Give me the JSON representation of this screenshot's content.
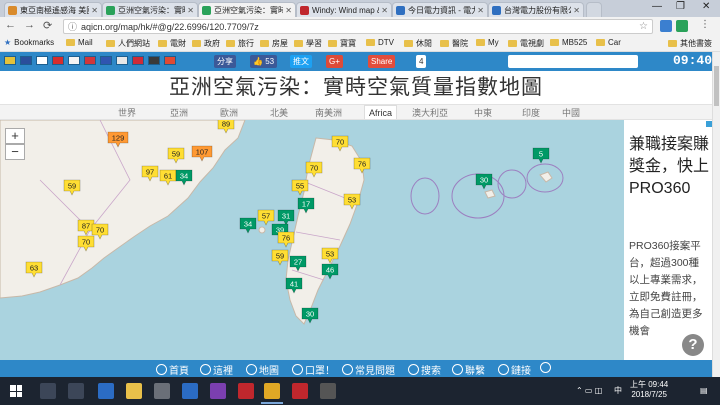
{
  "browser": {
    "tabs": [
      {
        "label": "東亞南極遙感海 美國",
        "color": "#d98b2c",
        "active": false
      },
      {
        "label": "亞洲空氣污染：實時",
        "color": "#2aa25a",
        "active": false
      },
      {
        "label": "亞洲空氣污染：實時",
        "color": "#2aa25a",
        "active": true
      },
      {
        "label": "Windy: Wind map & ",
        "color": "#c0272d",
        "active": false
      },
      {
        "label": "今日電力資訊 - 電力",
        "color": "#2f6fc0",
        "active": false
      },
      {
        "label": "台灣電力股份有限公",
        "color": "#2f6fc0",
        "active": false
      }
    ],
    "url": "aqicn.org/map/hk/#@g/22.6996/120.7709/7z",
    "bookmarks": [
      "Bookmarks",
      "Mail",
      "人們網站",
      "電財",
      "政府",
      "旅行",
      "房屋",
      "學習",
      "寶寶",
      "DTV",
      "休閒",
      "醫院",
      "My",
      "電視劇",
      "MB525",
      "Car"
    ],
    "other_bookmarks": "其他書簽"
  },
  "site": {
    "share_label": "分享",
    "like_count": "53",
    "weibo_label": "推文",
    "gplus_label": "G+",
    "share_btn_label": "Share",
    "share_count": "4",
    "clock": "09:40",
    "title": "亞洲空氣污染：實時空氣質量指數地圖",
    "regions": [
      "世界",
      "亞洲",
      "歐洲",
      "北美",
      "南美洲",
      "Africa",
      "澳大利亞",
      "中東",
      "印度",
      "中國"
    ],
    "active_region": "Africa"
  },
  "map": {
    "zoom_in": "+",
    "zoom_out": "−",
    "colors": {
      "good": "#009966",
      "moderate": "#ffde33",
      "sensitive": "#ff9933"
    },
    "stations": [
      {
        "value": "89",
        "level": "moderate"
      },
      {
        "value": "129",
        "level": "sensitive"
      },
      {
        "value": "59",
        "level": "moderate"
      },
      {
        "value": "107",
        "level": "sensitive"
      },
      {
        "value": "97",
        "level": "moderate"
      },
      {
        "value": "61",
        "level": "moderate"
      },
      {
        "value": "34",
        "level": "good"
      },
      {
        "value": "59",
        "level": "moderate"
      },
      {
        "value": "87",
        "level": "moderate"
      },
      {
        "value": "70",
        "level": "moderate"
      },
      {
        "value": "70",
        "level": "moderate"
      },
      {
        "value": "63",
        "level": "moderate"
      },
      {
        "value": "34",
        "level": "good"
      },
      {
        "value": "70",
        "level": "moderate"
      },
      {
        "value": "76",
        "level": "moderate"
      },
      {
        "value": "70",
        "level": "moderate"
      },
      {
        "value": "55",
        "level": "moderate"
      },
      {
        "value": "17",
        "level": "good"
      },
      {
        "value": "57",
        "level": "moderate"
      },
      {
        "value": "31",
        "level": "good"
      },
      {
        "value": "39",
        "level": "good"
      },
      {
        "value": "76",
        "level": "moderate"
      },
      {
        "value": "53",
        "level": "moderate"
      },
      {
        "value": "59",
        "level": "moderate"
      },
      {
        "value": "27",
        "level": "good"
      },
      {
        "value": "53",
        "level": "moderate"
      },
      {
        "value": "46",
        "level": "good"
      },
      {
        "value": "41",
        "level": "good"
      },
      {
        "value": "30",
        "level": "good"
      },
      {
        "value": "30",
        "level": "good"
      },
      {
        "value": "5",
        "level": "good"
      }
    ]
  },
  "ad": {
    "headline": "兼職接案賺獎金，快上PRO360",
    "body": "PRO360接案平台，超過300種以上專業需求，立即免費註冊，為自己創造更多機會",
    "help": "?"
  },
  "bottom_nav": [
    "首頁",
    "這裡",
    "地圖",
    "口罩！",
    "常見問題",
    "搜索",
    "聯繫",
    "鏈接"
  ],
  "taskbar": {
    "time": "上午 09:44",
    "date": "2018/7/25",
    "lang": "中"
  }
}
